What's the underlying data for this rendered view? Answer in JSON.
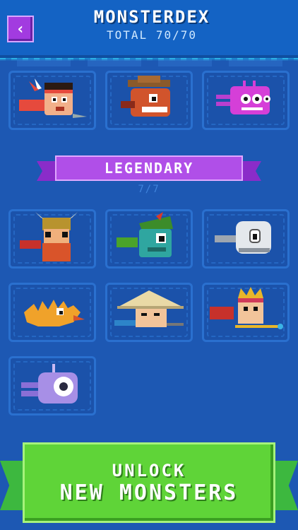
{
  "header": {
    "back_icon": "chevron-left-icon",
    "title": "MONSTERDEX",
    "subtitle": "TOTAL 70/70"
  },
  "section": {
    "label": "LEGENDARY",
    "count": "7/7"
  },
  "monsters_top": [
    {
      "name": "native-warrior-monster"
    },
    {
      "name": "cowboy-monster"
    },
    {
      "name": "purple-robot-monster"
    }
  ],
  "monsters_legendary": [
    {
      "name": "viking-monster"
    },
    {
      "name": "robin-hood-monster"
    },
    {
      "name": "ghost-monster"
    },
    {
      "name": "orange-spiky-monster"
    },
    {
      "name": "samurai-monster"
    },
    {
      "name": "king-monster"
    },
    {
      "name": "cyclops-robot-monster"
    }
  ],
  "cta": {
    "line1": "UNLOCK",
    "line2": "NEW MONSTERS"
  },
  "colors": {
    "background": "#1d58b3",
    "banner": "#b04fe8",
    "cta": "#5fd438"
  }
}
